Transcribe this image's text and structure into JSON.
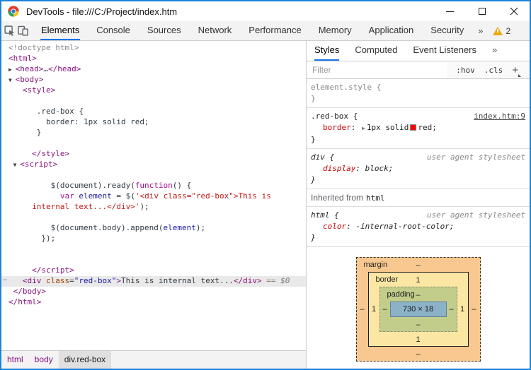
{
  "window": {
    "title": "DevTools - file:///C:/Project/index.htm"
  },
  "toolbar": {
    "tabs": [
      "Elements",
      "Console",
      "Sources",
      "Network",
      "Performance",
      "Memory",
      "Application",
      "Security"
    ],
    "selected_tab": "Elements",
    "more_tabs": "»",
    "warning_count": "2",
    "menu_icon": "⋮"
  },
  "elements_panel": {
    "lines": [
      {
        "seg": [
          [
            "gray",
            "<!doctype html>"
          ]
        ]
      },
      {
        "seg": [
          [
            "tag",
            "<html>"
          ]
        ]
      },
      {
        "seg": [
          [
            "arrow",
            "▶ "
          ],
          [
            "tag",
            "<head>"
          ],
          [
            "def",
            "…"
          ],
          [
            "tag",
            "</head>"
          ]
        ]
      },
      {
        "seg": [
          [
            "arrow",
            "▼ "
          ],
          [
            "tag",
            "<body>"
          ]
        ]
      },
      {
        "seg": [
          [
            "def",
            "   "
          ],
          [
            "tag",
            "<style>"
          ]
        ]
      },
      {
        "seg": []
      },
      {
        "seg": [
          [
            "def",
            "      .red-box {"
          ]
        ]
      },
      {
        "seg": [
          [
            "def",
            "        border: 1px solid red;"
          ]
        ]
      },
      {
        "seg": [
          [
            "def",
            "      }"
          ]
        ]
      },
      {
        "seg": []
      },
      {
        "seg": [
          [
            "def",
            "     "
          ],
          [
            "tag",
            "</style>"
          ]
        ]
      },
      {
        "seg": [
          [
            "def",
            " "
          ],
          [
            "arrow",
            "▼ "
          ],
          [
            "tag",
            "<script>"
          ]
        ]
      },
      {
        "seg": []
      },
      {
        "seg": [
          [
            "def",
            "         $(document).ready("
          ],
          [
            "kw",
            "function"
          ],
          [
            "def",
            "() {"
          ]
        ]
      },
      {
        "seg": [
          [
            "def",
            "           "
          ],
          [
            "kw",
            "var"
          ],
          [
            "def",
            " "
          ],
          [
            "var",
            "element"
          ],
          [
            "def",
            " = $("
          ],
          [
            "str",
            "'<div class=\"red-box\">This is"
          ]
        ]
      },
      {
        "seg": [
          [
            "str",
            "     internal text...</div>'"
          ],
          [
            "def",
            ");"
          ]
        ]
      },
      {
        "seg": []
      },
      {
        "seg": [
          [
            "def",
            "         $(document.body).append("
          ],
          [
            "var",
            "element"
          ],
          [
            "def",
            ");"
          ]
        ]
      },
      {
        "seg": [
          [
            "def",
            "       });"
          ]
        ]
      },
      {
        "seg": []
      },
      {
        "seg": []
      },
      {
        "seg": [
          [
            "def",
            "     "
          ],
          [
            "tag",
            "</script>"
          ]
        ]
      },
      {
        "sel": true,
        "dots": "…",
        "seg": [
          [
            "def",
            "   "
          ],
          [
            "tag",
            "<div"
          ],
          [
            "attr",
            " class"
          ],
          [
            "def",
            "="
          ],
          [
            "val",
            "\"red-box\""
          ],
          [
            "tag",
            ">"
          ],
          [
            "def",
            "This is internal text..."
          ],
          [
            "tag",
            "</div>"
          ],
          [
            "dim",
            " == $0"
          ]
        ]
      },
      {
        "seg": [
          [
            "def",
            " "
          ],
          [
            "tag",
            "</body>"
          ]
        ]
      },
      {
        "seg": [
          [
            "tag",
            "</html>"
          ]
        ]
      }
    ],
    "breadcrumbs": [
      {
        "label": "html",
        "selected": false
      },
      {
        "label": "body",
        "selected": false
      },
      {
        "label": "div.red-box",
        "selected": true
      }
    ]
  },
  "styles_panel": {
    "tabs": [
      "Styles",
      "Computed",
      "Event Listeners"
    ],
    "selected_tab": "Styles",
    "more_tabs": "»",
    "filter_placeholder": "Filter",
    "pseudo_button": ":hov",
    "class_button": ".cls",
    "add_button": "+",
    "separator": ": ",
    "element_style": {
      "open": "element.style {",
      "close": "}"
    },
    "red_box_rule": {
      "selector": ".red-box {",
      "source_link": "index.htm:9",
      "property": "border",
      "expand_arrow": "▶",
      "value_prefix": "1px solid",
      "value_color_name": "red;",
      "swatch_color": "#ff0000",
      "close": "}"
    },
    "div_rule": {
      "selector": "div {",
      "origin": "user agent stylesheet",
      "property": "display",
      "value": "block;",
      "close": "}"
    },
    "inherited": {
      "label": "Inherited from",
      "target": "html"
    },
    "html_rule": {
      "selector": "html {",
      "origin": "user agent stylesheet",
      "property": "color",
      "value": "-internal-root-color;",
      "close": "}"
    },
    "box_model": {
      "margin_label": "margin",
      "border_label": "border",
      "padding_label": "padding",
      "margin": {
        "top": "–",
        "right": "–",
        "bottom": "–",
        "left": "–"
      },
      "border": {
        "top": "1",
        "right": "1",
        "bottom": "1",
        "left": "1"
      },
      "padding": {
        "top": "–",
        "right": "–",
        "bottom": "–",
        "left": "–"
      },
      "content": "730 × 18"
    }
  },
  "colors": {
    "accent_blue": "#1a73e8",
    "window_border": "#1e82d8",
    "warning_yellow": "#eda712",
    "bm_margin": "#f8c890",
    "bm_border": "#fce6a4",
    "bm_padding": "#c2cd8c",
    "bm_content": "#8bb2c6"
  }
}
